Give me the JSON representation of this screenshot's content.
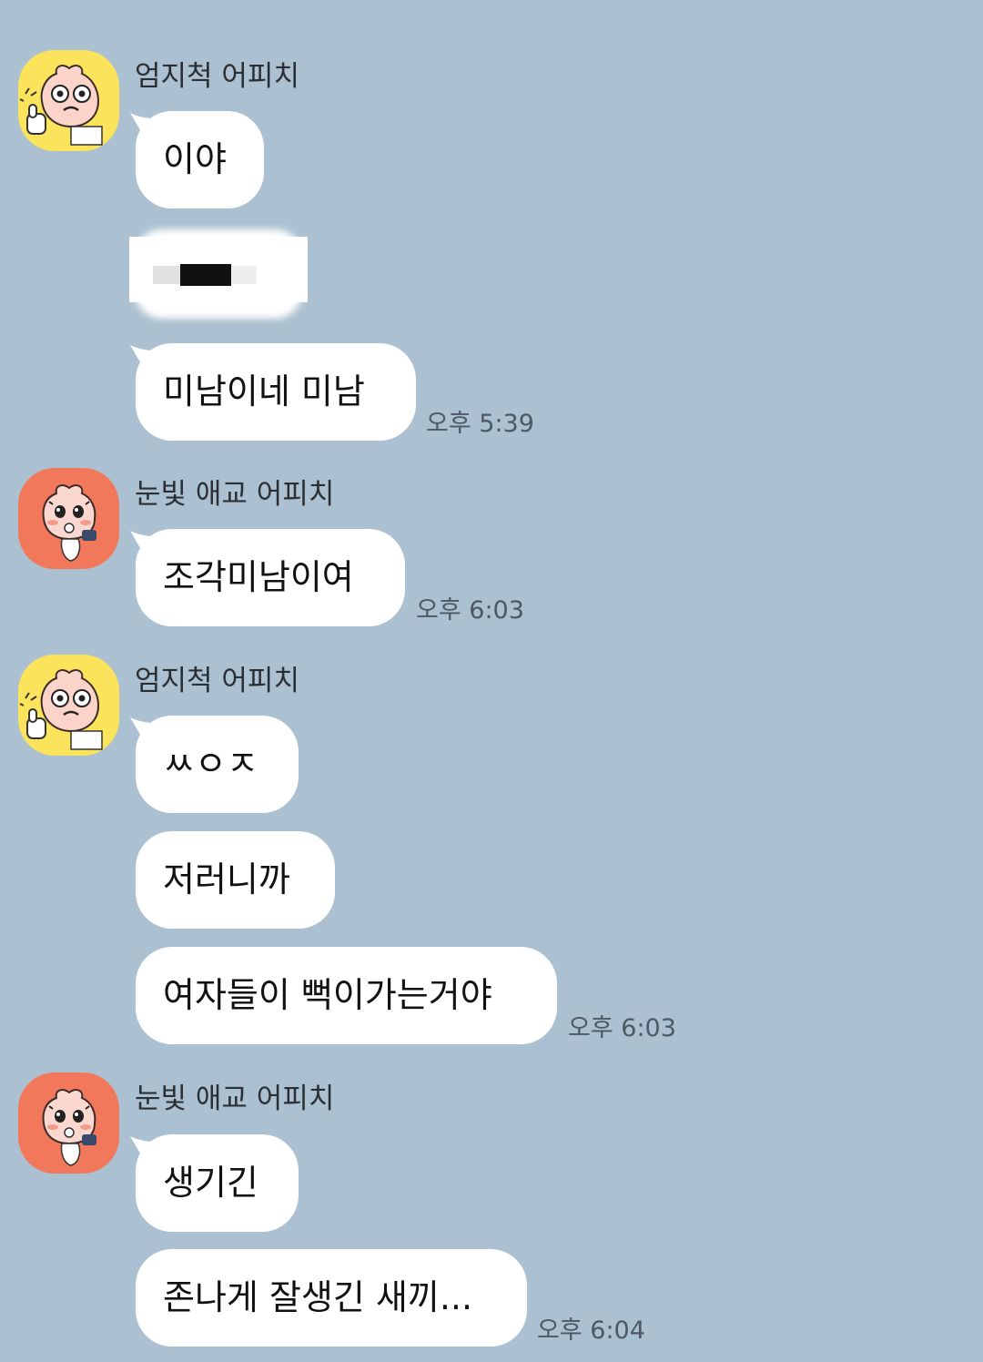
{
  "chat": {
    "background_color": "#abc1d1",
    "bubble_color": "#ffffff",
    "groups": [
      {
        "sender": "엄지척 어피치",
        "avatar_icon": "apeach-thumbs-up-icon",
        "avatar_color": "#fbe45c",
        "messages": [
          "이야",
          "미남이네 미남"
        ],
        "time": "오후 5:39"
      },
      {
        "sender": "눈빛 애교 어피치",
        "avatar_icon": "apeach-wink-icon",
        "avatar_color": "#f2785b",
        "messages": [
          "조각미남이여"
        ],
        "time": "오후 6:03"
      },
      {
        "sender": "엄지척 어피치",
        "avatar_icon": "apeach-thumbs-up-icon",
        "avatar_color": "#fbe45c",
        "messages": [
          "ㅆㅇㅈ",
          "저러니까",
          "여자들이 뻑이가는거야"
        ],
        "time": "오후 6:03"
      },
      {
        "sender": "눈빛 애교 어피치",
        "avatar_icon": "apeach-wink-icon",
        "avatar_color": "#f2785b",
        "messages": [
          "생기긴",
          "존나게 잘생긴 새끼..."
        ],
        "time": "오후 6:04"
      }
    ]
  }
}
